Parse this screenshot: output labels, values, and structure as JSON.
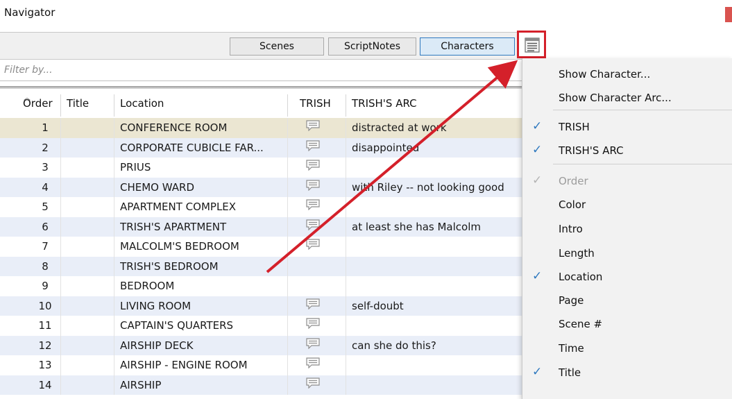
{
  "window": {
    "title": "Navigator"
  },
  "tabs": [
    {
      "label": "Scenes",
      "active": false
    },
    {
      "label": "ScriptNotes",
      "active": false
    },
    {
      "label": "Characters",
      "active": true
    }
  ],
  "column_menu_button": {
    "icon": "column-menu-icon"
  },
  "filter": {
    "placeholder": "Filter by...",
    "value": ""
  },
  "table": {
    "columns": [
      "Order",
      "Title",
      "Location",
      "TRISH",
      "TRISH'S ARC"
    ],
    "rows": [
      {
        "order": "1",
        "location": "CONFERENCE ROOM",
        "note": true,
        "arc": "distracted at work"
      },
      {
        "order": "2",
        "location": "CORPORATE CUBICLE FAR...",
        "note": true,
        "arc": "disappointed"
      },
      {
        "order": "3",
        "location": "PRIUS",
        "note": true,
        "arc": ""
      },
      {
        "order": "4",
        "location": "CHEMO WARD",
        "note": true,
        "arc": "with Riley -- not looking good"
      },
      {
        "order": "5",
        "location": "APARTMENT COMPLEX",
        "note": true,
        "arc": ""
      },
      {
        "order": "6",
        "location": "TRISH'S APARTMENT",
        "note": true,
        "arc": "at least she has Malcolm"
      },
      {
        "order": "7",
        "location": "MALCOLM'S BEDROOM",
        "note": true,
        "arc": ""
      },
      {
        "order": "8",
        "location": "TRISH'S BEDROOM",
        "note": false,
        "arc": ""
      },
      {
        "order": "9",
        "location": "BEDROOM",
        "note": false,
        "arc": ""
      },
      {
        "order": "10",
        "location": "LIVING ROOM",
        "note": true,
        "arc": "self-doubt"
      },
      {
        "order": "11",
        "location": "CAPTAIN'S QUARTERS",
        "note": true,
        "arc": ""
      },
      {
        "order": "12",
        "location": "AIRSHIP DECK",
        "note": true,
        "arc": "can she do this?"
      },
      {
        "order": "13",
        "location": "AIRSHIP - ENGINE ROOM",
        "note": true,
        "arc": ""
      },
      {
        "order": "14",
        "location": "AIRSHIP",
        "note": true,
        "arc": ""
      }
    ]
  },
  "context_menu": {
    "items": [
      {
        "label": "Show Character...",
        "checked": false,
        "disabled": false
      },
      {
        "label": "Show Character Arc...",
        "checked": false,
        "disabled": false
      },
      {
        "label": "TRISH",
        "checked": true,
        "disabled": false
      },
      {
        "label": "TRISH'S ARC",
        "checked": true,
        "disabled": false
      },
      {
        "label": "Order",
        "checked": true,
        "disabled": true
      },
      {
        "label": "Color",
        "checked": false,
        "disabled": false
      },
      {
        "label": "Intro",
        "checked": false,
        "disabled": false
      },
      {
        "label": "Length",
        "checked": false,
        "disabled": false
      },
      {
        "label": "Location",
        "checked": true,
        "disabled": false
      },
      {
        "label": "Page",
        "checked": false,
        "disabled": false
      },
      {
        "label": "Scene #",
        "checked": false,
        "disabled": false
      },
      {
        "label": "Time",
        "checked": false,
        "disabled": false
      },
      {
        "label": "Title",
        "checked": true,
        "disabled": false
      }
    ]
  },
  "colors": {
    "highlight_red": "#d4202a",
    "accent_blue": "#2f79bf",
    "row_alt": "#e9eef8",
    "row_selected": "#ebe6d2"
  }
}
